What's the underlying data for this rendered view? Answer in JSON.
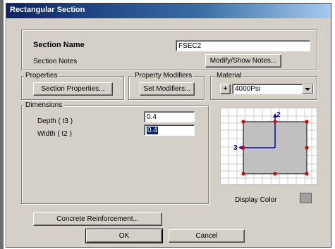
{
  "window": {
    "title": "Rectangular Section"
  },
  "section": {
    "name_label": "Section Name",
    "name_value": "FSEC2",
    "notes_label": "Section Notes",
    "notes_button": "Modify/Show Notes..."
  },
  "properties": {
    "group_label": "Properties",
    "button": "Section Properties..."
  },
  "modifiers": {
    "group_label": "Property Modifiers",
    "button": "Set Modifiers..."
  },
  "material": {
    "group_label": "Material",
    "add_button": "+",
    "selected": "4000Psi"
  },
  "dimensions": {
    "group_label": "Dimensions",
    "depth_label": "Depth  ( t3 )",
    "depth_value": "0.4",
    "width_label": "Width  ( t2 )",
    "width_value": "0.4"
  },
  "preview": {
    "axis2_label": "2",
    "axis3_label": "3",
    "display_color_label": "Display Color",
    "display_color": "#a0a0a0",
    "section_fill": "#c0c0c0",
    "point_color": "#e00000",
    "axis_color": "#0000cc"
  },
  "buttons": {
    "reinforcement": "Concrete Reinforcement...",
    "ok": "OK",
    "cancel": "Cancel"
  }
}
